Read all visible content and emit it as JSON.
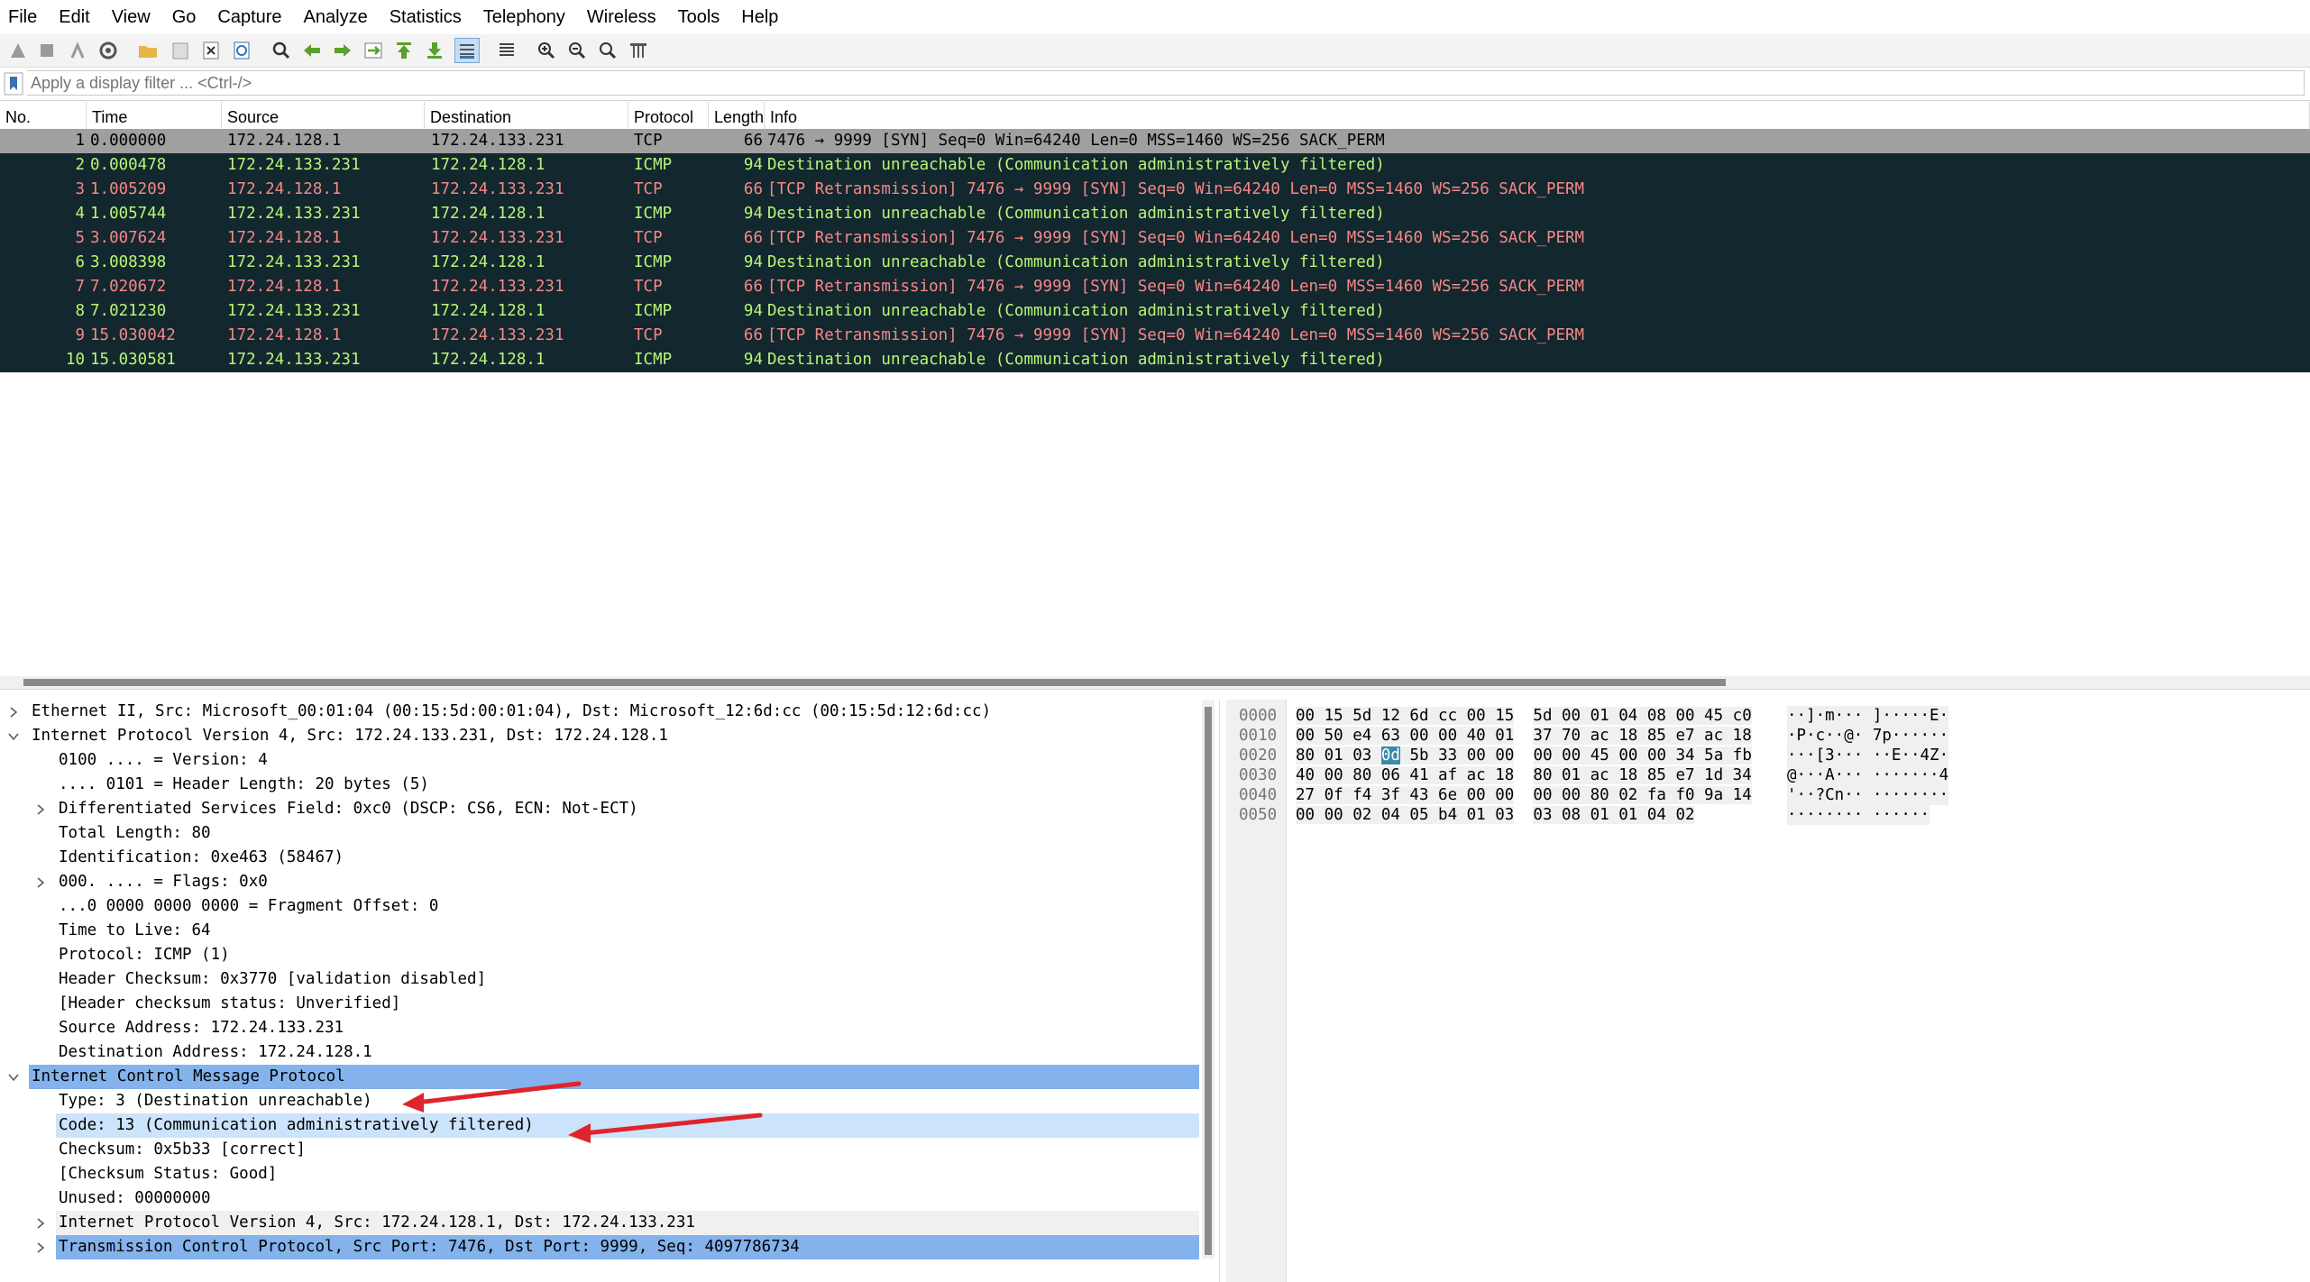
{
  "menu": [
    "File",
    "Edit",
    "View",
    "Go",
    "Capture",
    "Analyze",
    "Statistics",
    "Telephony",
    "Wireless",
    "Tools",
    "Help"
  ],
  "filter": {
    "placeholder": "Apply a display filter ... <Ctrl-/>"
  },
  "packet_list": {
    "columns": [
      "No.",
      "Time",
      "Source",
      "Destination",
      "Protocol",
      "Length",
      "Info"
    ],
    "rows": [
      {
        "no": "1",
        "time": "0.000000",
        "src": "172.24.128.1",
        "dst": "172.24.133.231",
        "proto": "TCP",
        "len": "66",
        "info": "7476 → 9999 [SYN] Seq=0 Win=64240 Len=0 MSS=1460 WS=256 SACK_PERM",
        "style": "selected"
      },
      {
        "no": "2",
        "time": "0.000478",
        "src": "172.24.133.231",
        "dst": "172.24.128.1",
        "proto": "ICMP",
        "len": "94",
        "info": "Destination unreachable (Communication administratively filtered)",
        "style": "icmp"
      },
      {
        "no": "3",
        "time": "1.005209",
        "src": "172.24.128.1",
        "dst": "172.24.133.231",
        "proto": "TCP",
        "len": "66",
        "info": "[TCP Retransmission] 7476 → 9999 [SYN] Seq=0 Win=64240 Len=0 MSS=1460 WS=256 SACK_PERM",
        "style": "retrans"
      },
      {
        "no": "4",
        "time": "1.005744",
        "src": "172.24.133.231",
        "dst": "172.24.128.1",
        "proto": "ICMP",
        "len": "94",
        "info": "Destination unreachable (Communication administratively filtered)",
        "style": "icmp"
      },
      {
        "no": "5",
        "time": "3.007624",
        "src": "172.24.128.1",
        "dst": "172.24.133.231",
        "proto": "TCP",
        "len": "66",
        "info": "[TCP Retransmission] 7476 → 9999 [SYN] Seq=0 Win=64240 Len=0 MSS=1460 WS=256 SACK_PERM",
        "style": "retrans"
      },
      {
        "no": "6",
        "time": "3.008398",
        "src": "172.24.133.231",
        "dst": "172.24.128.1",
        "proto": "ICMP",
        "len": "94",
        "info": "Destination unreachable (Communication administratively filtered)",
        "style": "icmp"
      },
      {
        "no": "7",
        "time": "7.020672",
        "src": "172.24.128.1",
        "dst": "172.24.133.231",
        "proto": "TCP",
        "len": "66",
        "info": "[TCP Retransmission] 7476 → 9999 [SYN] Seq=0 Win=64240 Len=0 MSS=1460 WS=256 SACK_PERM",
        "style": "retrans"
      },
      {
        "no": "8",
        "time": "7.021230",
        "src": "172.24.133.231",
        "dst": "172.24.128.1",
        "proto": "ICMP",
        "len": "94",
        "info": "Destination unreachable (Communication administratively filtered)",
        "style": "icmp"
      },
      {
        "no": "9",
        "time": "15.030042",
        "src": "172.24.128.1",
        "dst": "172.24.133.231",
        "proto": "TCP",
        "len": "66",
        "info": "[TCP Retransmission] 7476 → 9999 [SYN] Seq=0 Win=64240 Len=0 MSS=1460 WS=256 SACK_PERM",
        "style": "retrans"
      },
      {
        "no": "10",
        "time": "15.030581",
        "src": "172.24.133.231",
        "dst": "172.24.128.1",
        "proto": "ICMP",
        "len": "94",
        "info": "Destination unreachable (Communication administratively filtered)",
        "style": "icmp"
      }
    ]
  },
  "details": [
    {
      "text": "Ethernet II, Src: Microsoft_00:01:04 (00:15:5d:00:01:04), Dst: Microsoft_12:6d:cc (00:15:5d:12:6d:cc)",
      "level": 0,
      "exp": "collapsed",
      "style": "normal"
    },
    {
      "text": "Internet Protocol Version 4, Src: 172.24.133.231, Dst: 172.24.128.1",
      "level": 0,
      "exp": "expanded",
      "style": "normal"
    },
    {
      "text": "0100 .... = Version: 4",
      "level": 1,
      "exp": "none",
      "style": "normal"
    },
    {
      "text": ".... 0101 = Header Length: 20 bytes (5)",
      "level": 1,
      "exp": "none",
      "style": "normal"
    },
    {
      "text": "Differentiated Services Field: 0xc0 (DSCP: CS6, ECN: Not-ECT)",
      "level": 1,
      "exp": "collapsed",
      "style": "normal"
    },
    {
      "text": "Total Length: 80",
      "level": 1,
      "exp": "none",
      "style": "normal"
    },
    {
      "text": "Identification: 0xe463 (58467)",
      "level": 1,
      "exp": "none",
      "style": "normal"
    },
    {
      "text": "000. .... = Flags: 0x0",
      "level": 1,
      "exp": "collapsed",
      "style": "normal"
    },
    {
      "text": "...0 0000 0000 0000 = Fragment Offset: 0",
      "level": 1,
      "exp": "none",
      "style": "normal"
    },
    {
      "text": "Time to Live: 64",
      "level": 1,
      "exp": "none",
      "style": "normal"
    },
    {
      "text": "Protocol: ICMP (1)",
      "level": 1,
      "exp": "none",
      "style": "normal"
    },
    {
      "text": "Header Checksum: 0x3770 [validation disabled]",
      "level": 1,
      "exp": "none",
      "style": "normal"
    },
    {
      "text": "[Header checksum status: Unverified]",
      "level": 1,
      "exp": "none",
      "style": "normal"
    },
    {
      "text": "Source Address: 172.24.133.231",
      "level": 1,
      "exp": "none",
      "style": "normal"
    },
    {
      "text": "Destination Address: 172.24.128.1",
      "level": 1,
      "exp": "none",
      "style": "normal"
    },
    {
      "text": "Internet Control Message Protocol",
      "level": 0,
      "exp": "expanded",
      "style": "header-sel"
    },
    {
      "text": "Type: 3 (Destination unreachable)",
      "level": 1,
      "exp": "none",
      "style": "normal"
    },
    {
      "text": "Code: 13 (Communication administratively filtered)",
      "level": 1,
      "exp": "none",
      "style": "light"
    },
    {
      "text": "Checksum: 0x5b33 [correct]",
      "level": 1,
      "exp": "none",
      "style": "normal"
    },
    {
      "text": "[Checksum Status: Good]",
      "level": 1,
      "exp": "none",
      "style": "normal"
    },
    {
      "text": "Unused: 00000000",
      "level": 1,
      "exp": "none",
      "style": "normal"
    },
    {
      "text": "Internet Protocol Version 4, Src: 172.24.128.1, Dst: 172.24.133.231",
      "level": 1,
      "exp": "collapsed",
      "style": "grey"
    },
    {
      "text": "Transmission Control Protocol, Src Port: 7476, Dst Port: 9999, Seq: 4097786734",
      "level": 1,
      "exp": "collapsed",
      "style": "selected"
    }
  ],
  "bytes": {
    "offsets": [
      "0000",
      "0010",
      "0020",
      "0030",
      "0040",
      "0050"
    ],
    "hex": [
      [
        "00 15 5d 12 6d cc 00 15",
        "5d 00 01 04 08 00 45 c0"
      ],
      [
        "00 50 e4 63 00 00 40 01",
        "37 70 ac 18 85 e7 ac 18"
      ],
      [
        "80 01 03 0d 5b 33 00 00",
        "00 00 45 00 00 34 5a fb"
      ],
      [
        "40 00 80 06 41 af ac 18",
        "80 01 ac 18 85 e7 1d 34"
      ],
      [
        "27 0f f4 3f 43 6e 00 00",
        "00 00 80 02 fa f0 9a 14"
      ],
      [
        "00 00 02 04 05 b4 01 03",
        "03 08 01 01 04 02"
      ]
    ],
    "ascii": [
      "··]·m··· ]·····E·",
      "·P·c··@· 7p······",
      "···[3··· ··E··4Z·",
      "@···A··· ·······4",
      "'··?Cn·· ········",
      "········ ······"
    ],
    "highlight_byte": "0d"
  },
  "colors": {
    "selected_row_bg": "#a0a0a0",
    "dark_row_bg": "#12272e",
    "retrans_fg": "#f78787",
    "icmp_fg": "#b7f774",
    "tree_selected_bg": "#83b2ec",
    "tree_light_bg": "#cbe4fb",
    "annotation_arrow": "#e0242b"
  }
}
